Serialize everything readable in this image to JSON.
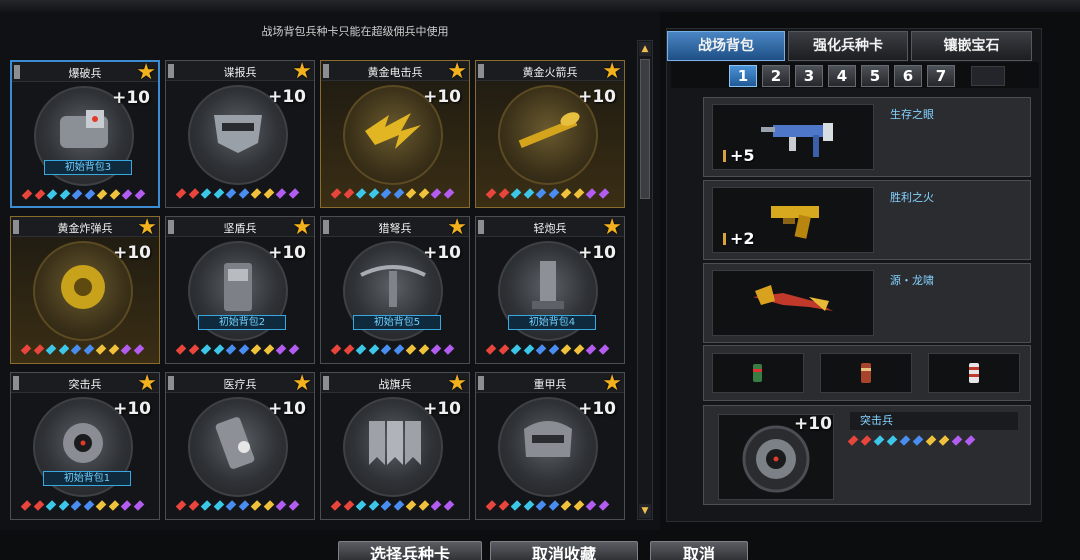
{
  "notice": "战场背包兵种卡只能在超级佣兵中使用",
  "cards": [
    {
      "name": "爆破兵",
      "plus": "+10",
      "badge": "初始背包3",
      "style": "normal",
      "selected": true,
      "icon": "explosive-pack-icon"
    },
    {
      "name": "谍报兵",
      "plus": "+10",
      "badge": "",
      "style": "normal",
      "selected": false,
      "icon": "spy-mask-icon"
    },
    {
      "name": "黄金电击兵",
      "plus": "+10",
      "badge": "",
      "style": "gold",
      "selected": false,
      "icon": "lightning-claw-icon"
    },
    {
      "name": "黄金火箭兵",
      "plus": "+10",
      "badge": "",
      "style": "gold",
      "selected": false,
      "icon": "rocket-launcher-icon"
    },
    {
      "name": "黄金炸弹兵",
      "plus": "+10",
      "badge": "",
      "style": "gold",
      "selected": false,
      "icon": "gold-mine-icon"
    },
    {
      "name": "坚盾兵",
      "plus": "+10",
      "badge": "初始背包2",
      "style": "normal",
      "selected": false,
      "icon": "riot-shield-icon"
    },
    {
      "name": "猎弩兵",
      "plus": "+10",
      "badge": "初始背包5",
      "style": "normal",
      "selected": false,
      "icon": "crossbow-icon"
    },
    {
      "name": "轻炮兵",
      "plus": "+10",
      "badge": "初始背包4",
      "style": "normal",
      "selected": false,
      "icon": "mortar-icon"
    },
    {
      "name": "突击兵",
      "plus": "+10",
      "badge": "初始背包1",
      "style": "normal",
      "selected": false,
      "icon": "assault-helmet-icon"
    },
    {
      "name": "医疗兵",
      "plus": "+10",
      "badge": "",
      "style": "normal",
      "selected": false,
      "icon": "medkit-icon"
    },
    {
      "name": "战旗兵",
      "plus": "+10",
      "badge": "",
      "style": "normal",
      "selected": false,
      "icon": "war-flags-icon"
    },
    {
      "name": "重甲兵",
      "plus": "+10",
      "badge": "",
      "style": "normal",
      "selected": false,
      "icon": "heavy-armor-icon"
    }
  ],
  "gem_colors": [
    "#e8453c",
    "#e8453c",
    "#3cc7e8",
    "#3cc7e8",
    "#4a8df0",
    "#4a8df0",
    "#f0c23c",
    "#f0c23c",
    "#b35cf0",
    "#b35cf0"
  ],
  "tabs": [
    {
      "label": "战场背包",
      "active": true
    },
    {
      "label": "强化兵种卡",
      "active": false
    },
    {
      "label": "镶嵌宝石",
      "active": false
    }
  ],
  "pages": [
    "1",
    "2",
    "3",
    "4",
    "5",
    "6",
    "7"
  ],
  "active_page": "1",
  "weapons": [
    {
      "name": "生存之眼",
      "qty": "+5",
      "icon": "smg-icon"
    },
    {
      "name": "胜利之火",
      "qty": "+2",
      "icon": "gold-pistol-icon"
    },
    {
      "name": "源・龙啸",
      "qty": "",
      "icon": "dragon-axe-icon"
    }
  ],
  "grenade_icons": [
    "green-grenade-icon",
    "red-grenade-icon",
    "white-grenade-icon"
  ],
  "selected_soldier": {
    "name": "突击兵",
    "plus": "+10",
    "icon": "assault-helmet-icon"
  },
  "buttons": {
    "select": "选择兵种卡",
    "unfavorite": "取消收藏",
    "cancel": "取消"
  },
  "colors": {
    "accent_blue": "#3d8bd0",
    "gold_star": "#f3b11e",
    "badge_text": "#6fd0ff"
  }
}
